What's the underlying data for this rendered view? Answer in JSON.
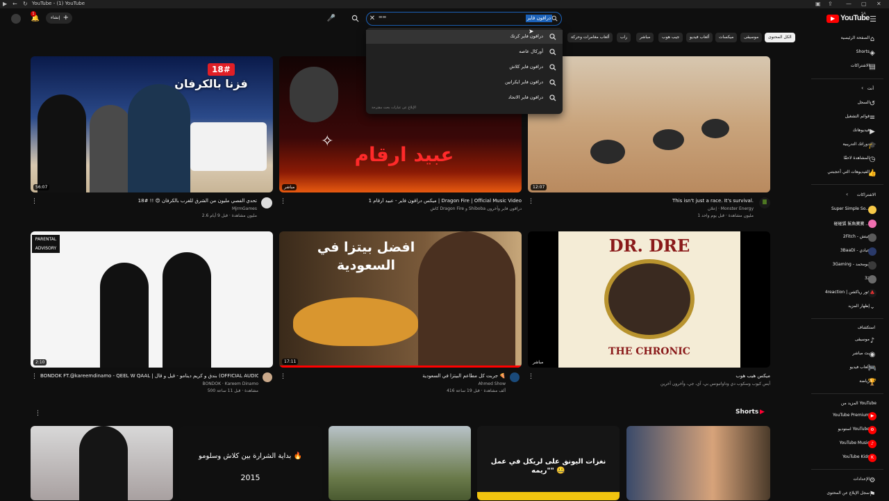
{
  "window": {
    "title": "YouTube - (1) YouTube"
  },
  "header": {
    "logo_text": "YouTube",
    "logo_region": "SA",
    "create_label": "إنشاء",
    "notification_count": "1",
    "search": {
      "value": "درافون فاير",
      "ghost": "▬▬"
    }
  },
  "chips": [
    "الكل المحتوى",
    "موسيقى",
    "ميكسات",
    "ألعاب فيديو",
    "جيب هوب",
    "مباشر",
    "راب",
    "ألعاب مغامرات وحركة"
  ],
  "suggestions": [
    "دراقون فاير كرتك",
    "أوركال عاصه",
    "دراقون فاير كلاش",
    "دراقون فاير ايكراتين",
    "دراقون فاير الاتحاد"
  ],
  "suggestions_footer": "الإبلاغ عن عبارات بحث مقترحة",
  "videos": [
    {
      "title": "تحدي الفصي مليون من الشرق للغرب بالكرفان 😍 !! #18",
      "channel": "MjrmGames",
      "meta": "2.6 مليون مشاهدة · قبل 9 أيام",
      "duration": "56:07",
      "thumb_text": "فزنا بالكرفان",
      "thumb_badge": "18#"
    },
    {
      "title": "ميكس دراقون فاير - عبيد أرقام 1 | Dragon Fire | Official Music Video",
      "channel": "كاش Dragon Fire و Shiboba دراقون فاير وآخرون",
      "meta": "",
      "duration": "مباشر",
      "thumb_text": "عبيد ارقام",
      "thumb_badge": ""
    },
    {
      "title": "This isn't just a race. It's survival.",
      "channel": "إعلان · Monster Energy",
      "meta": "1 مليون مشاهدة · قبل يوم واحد",
      "duration": "12:07",
      "thumb_text": "",
      "thumb_badge": ""
    },
    {
      "title": "BONDOK FT.@kareemdinamo - QEEL W QAAL | بندق و كريم دينامو - قيل و قال (OFFICIAL AUDIO)",
      "channel": "BONDOK · Kareem Dinamo",
      "meta": "500 مشاهدة · قبل 11 ساعة",
      "duration": "2:10",
      "thumb_text": "",
      "thumb_badge": ""
    },
    {
      "title": "جربت كل مطاعم البيتزا في السعودية 🍕",
      "channel": "Ahmed Show",
      "meta": "416 ألف مشاهدة · قبل 19 ساعة",
      "duration": "17:11",
      "thumb_text": "افضل بيتزا في السعودية",
      "thumb_badge": ""
    },
    {
      "title": "ميكس هيب هوب",
      "channel": "آيس كيوب وسكوب دي وداوانبونس بي، آي، جي، وآخرون آخرين",
      "meta": "",
      "duration": "مباشر",
      "thumb_text": "DR. DRE",
      "thumb_badge": "THE CHRONIC"
    }
  ],
  "shorts": {
    "title": "Shorts",
    "items": [
      {
        "text": ""
      },
      {
        "text": "بداية الشرارة بين كلاش وسلومو 🔥",
        "sub": "2015"
      },
      {
        "text": ""
      },
      {
        "text": "نغزات اليونق على لريكل في عمل \"ريمه\" 🤐"
      },
      {
        "text": ""
      }
    ]
  },
  "sidebar": {
    "main": [
      "الصفحة الرئيسية",
      "Shorts",
      "الاشتراكات"
    ],
    "you_header": "أنت",
    "you": [
      "السجل",
      "قوائم التشغيل",
      "فيديوهاتك",
      "دوراتك التدريبية",
      "المشاهدة لاحقًا",
      "الفيديوهات التي أعجبتني"
    ],
    "subs_header": "الاشتراكات",
    "subs": [
      "Super Simple So...",
      "碰碰狐 鯊魚寶寶 ...",
      "2Fitch - فيتش",
      "3BaaDi - عبادي",
      "3Gaming - ابومحمد",
      "3z",
      "4reaction | فور رياكشن"
    ],
    "subs_more": "إظهار المزيد",
    "explore_header": "استكشاف",
    "explore": [
      "موسيقى",
      "بث مباشر",
      "ألعاب فيديو",
      "رياضة"
    ],
    "more_header": "المزيد من YouTube",
    "more": [
      "YouTube Premium",
      "استوديو YouTube",
      "YouTube Music",
      "YouTube Kids"
    ],
    "settings": [
      "الإعدادات",
      "سجل الإبلاغ عن المحتوى"
    ]
  },
  "colors": {
    "accent": "#ff0000",
    "selection": "#1c62b9",
    "bg": "#0f0f0f"
  }
}
